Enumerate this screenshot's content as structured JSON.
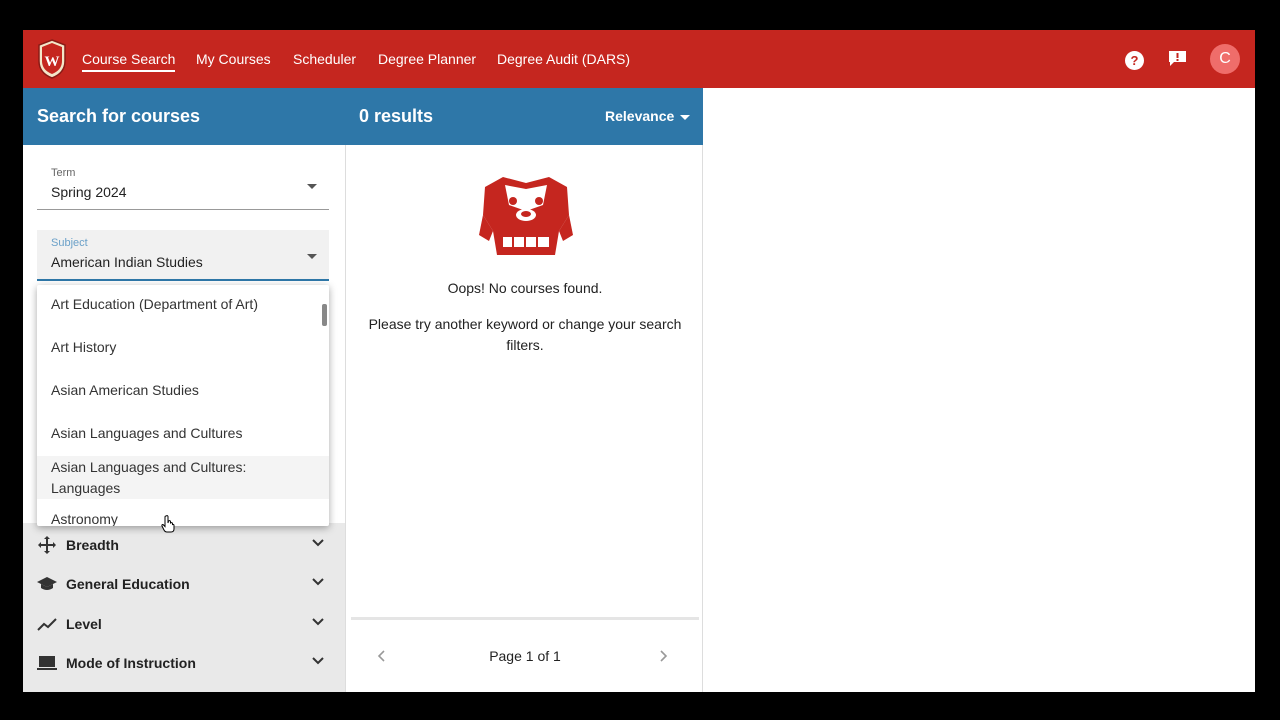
{
  "nav": {
    "links": [
      {
        "label": "Course Search",
        "active": true
      },
      {
        "label": "My Courses",
        "active": false
      },
      {
        "label": "Scheduler",
        "active": false
      },
      {
        "label": "Degree Planner",
        "active": false
      },
      {
        "label": "Degree Audit (DARS)",
        "active": false
      }
    ],
    "help_glyph": "?",
    "avatar_initial": "C",
    "brand_color": "#c5261f"
  },
  "search_panel": {
    "title": "Search for courses",
    "term": {
      "label": "Term",
      "value": "Spring 2024"
    },
    "subject": {
      "label": "Subject",
      "value": "American Indian Studies"
    },
    "subject_options": [
      "Art Education (Department of Art)",
      "Art History",
      "Asian American Studies",
      "Asian Languages and Cultures",
      "Asian Languages and Cultures: Languages",
      "Astronomy"
    ],
    "hovered_option": "Asian Languages and Cultures: Languages",
    "filters": [
      {
        "label": "Breadth",
        "icon": "breadth-icon"
      },
      {
        "label": "General Education",
        "icon": "graduation-cap-icon"
      },
      {
        "label": "Level",
        "icon": "trend-icon"
      },
      {
        "label": "Mode of Instruction",
        "icon": "laptop-icon"
      }
    ],
    "header_color": "#2e77a8"
  },
  "results_panel": {
    "count_label": "0 results",
    "sort_label": "Relevance",
    "empty_title": "Oops! No courses found.",
    "empty_message": "Please try another keyword or change your search filters.",
    "pager_text": "Page 1 of 1"
  }
}
